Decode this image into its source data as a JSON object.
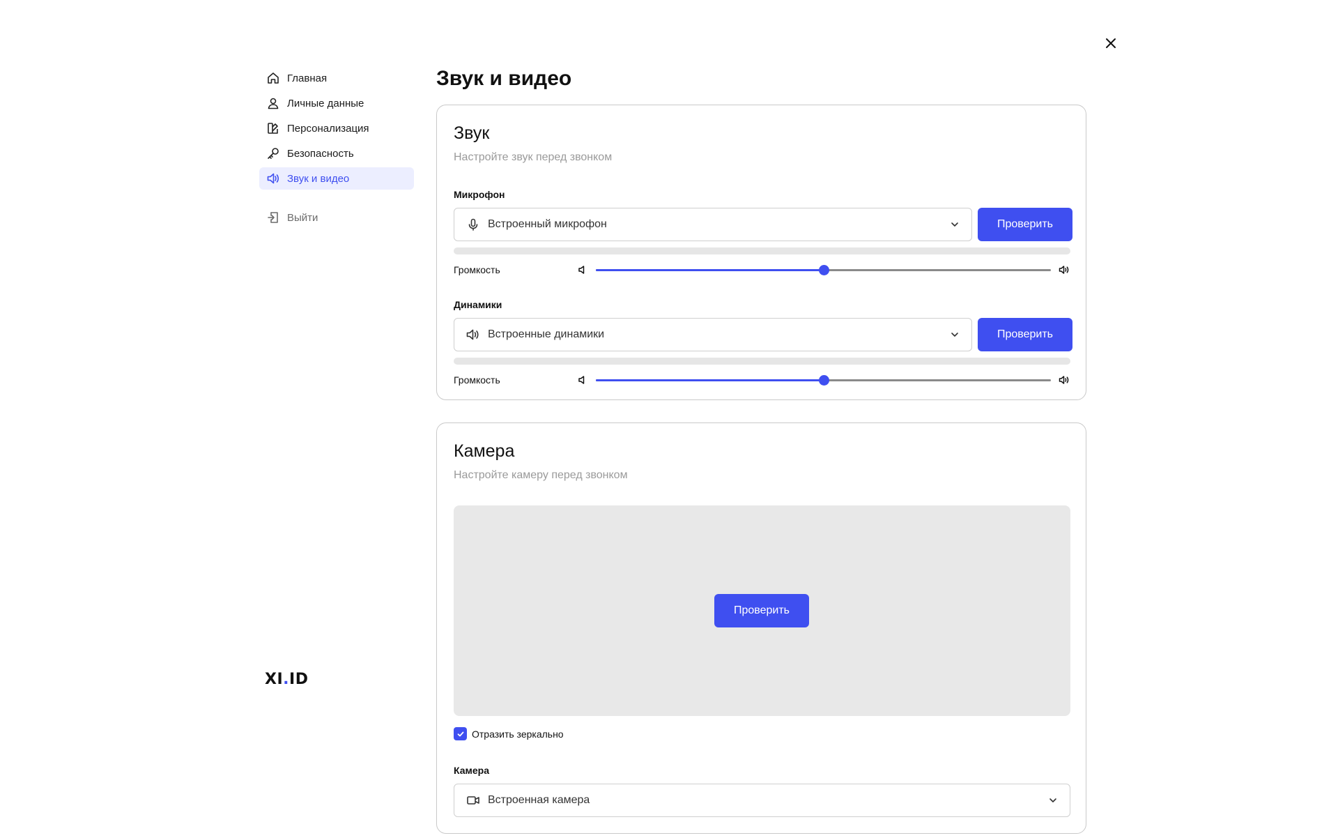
{
  "page": {
    "title": "Звук и видео"
  },
  "colors": {
    "accent": "#3f4ff0",
    "active_bg": "#eceeff",
    "preview_bg": "#e8e8e8"
  },
  "sidebar": {
    "items": [
      {
        "label": "Главная",
        "icon": "home-icon"
      },
      {
        "label": "Личные данные",
        "icon": "user-icon"
      },
      {
        "label": "Персонализация",
        "icon": "palette-icon"
      },
      {
        "label": "Безопасность",
        "icon": "key-icon"
      },
      {
        "label": "Звук и видео",
        "icon": "speaker-icon",
        "active": true
      }
    ],
    "logout": {
      "label": "Выйти",
      "icon": "logout-icon"
    },
    "brand": {
      "left": "XI",
      "dot": ".",
      "right": "ID"
    }
  },
  "audio": {
    "title": "Звук",
    "subtitle": "Настройте звук перед звонком",
    "microphone": {
      "label": "Микрофон",
      "selected": "Встроенный микрофон",
      "test_label": "Проверить",
      "level": 0,
      "volume_label": "Громкость",
      "volume": 0.5
    },
    "speakers": {
      "label": "Динамики",
      "selected": "Встроенные динамики",
      "test_label": "Проверить",
      "level": 0,
      "volume_label": "Громкость",
      "volume": 0.5
    }
  },
  "camera": {
    "title": "Камера",
    "subtitle": "Настройте камеру перед звонком",
    "test_label": "Проверить",
    "mirror_label": "Отразить зеркально",
    "mirror_checked": true,
    "device_label": "Камера",
    "selected": "Встроенная камера"
  }
}
